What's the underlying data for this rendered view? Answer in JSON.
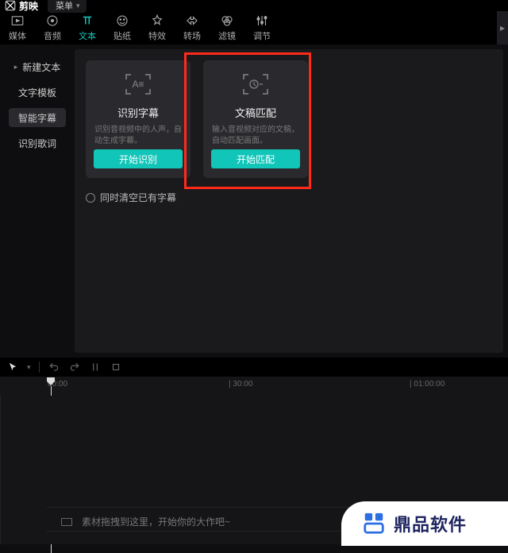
{
  "titlebar": {
    "app_name": "剪映",
    "menu_label": "菜单"
  },
  "toolbar": {
    "items": [
      {
        "label": "媒体"
      },
      {
        "label": "音频"
      },
      {
        "label": "文本"
      },
      {
        "label": "贴纸"
      },
      {
        "label": "特效"
      },
      {
        "label": "转场"
      },
      {
        "label": "滤镜"
      },
      {
        "label": "调节"
      }
    ],
    "active_index": 2
  },
  "sidebar": {
    "items": [
      {
        "label": "新建文本",
        "has_arrow": true
      },
      {
        "label": "文字模板"
      },
      {
        "label": "智能字幕"
      },
      {
        "label": "识别歌词"
      }
    ],
    "active_index": 2
  },
  "cards": [
    {
      "title": "识别字幕",
      "desc": "识别音视频中的人声，自动生成字幕。",
      "button": "开始识别"
    },
    {
      "title": "文稿匹配",
      "desc": "输入音视频对应的文稿，自动匹配画面。",
      "button": "开始匹配"
    }
  ],
  "checkbox_label": "同时清空已有字幕",
  "ruler": {
    "marks": [
      "00:00",
      "| 30:00",
      "| 01:00:00"
    ]
  },
  "timeline_hint": "素材拖拽到这里，开始你的大作吧~",
  "watermark": "鼎品软件"
}
